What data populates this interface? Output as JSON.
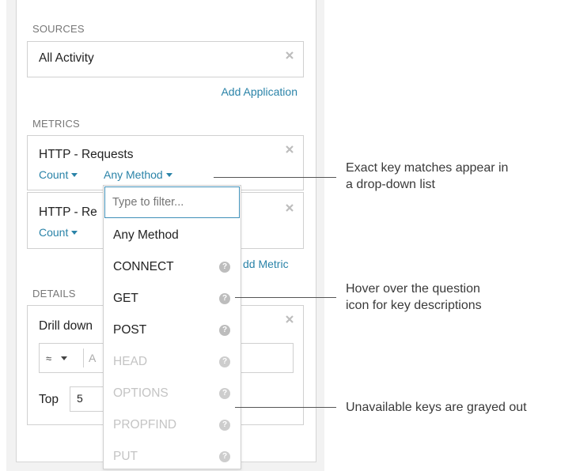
{
  "sources": {
    "label": "SOURCES",
    "value": "All Activity",
    "add_link": "Add Application"
  },
  "metrics": {
    "label": "METRICS",
    "items": [
      {
        "title": "HTTP - Requests",
        "agg": "Count",
        "method": "Any Method"
      },
      {
        "title": "HTTP - Re",
        "agg": "Count"
      }
    ],
    "add_link": "Add Metric",
    "add_link_visible": "dd Metric"
  },
  "details": {
    "label": "DETAILS",
    "drill_label": "Drill down",
    "operator": "≈",
    "input_partial": "A",
    "top_label": "Top",
    "top_value": "5"
  },
  "dropdown": {
    "placeholder": "Type to filter...",
    "options": [
      {
        "label": "Any Method",
        "enabled": true,
        "help": false
      },
      {
        "label": "CONNECT",
        "enabled": true,
        "help": true
      },
      {
        "label": "GET",
        "enabled": true,
        "help": true
      },
      {
        "label": "POST",
        "enabled": true,
        "help": true
      },
      {
        "label": "HEAD",
        "enabled": false,
        "help": true
      },
      {
        "label": "OPTIONS",
        "enabled": false,
        "help": true
      },
      {
        "label": "PROPFIND",
        "enabled": false,
        "help": true
      },
      {
        "label": "PUT",
        "enabled": false,
        "help": true
      }
    ]
  },
  "callouts": {
    "first_line1": "Exact key matches appear in",
    "first_line2": "a drop-down list",
    "second_line1": "Hover over the question",
    "second_line2": "icon for key descriptions",
    "third": "Unavailable keys are grayed out"
  },
  "colors": {
    "link": "#2a83a8",
    "focus_border": "#3f8fb8",
    "disabled_text": "#c4c4c4"
  }
}
